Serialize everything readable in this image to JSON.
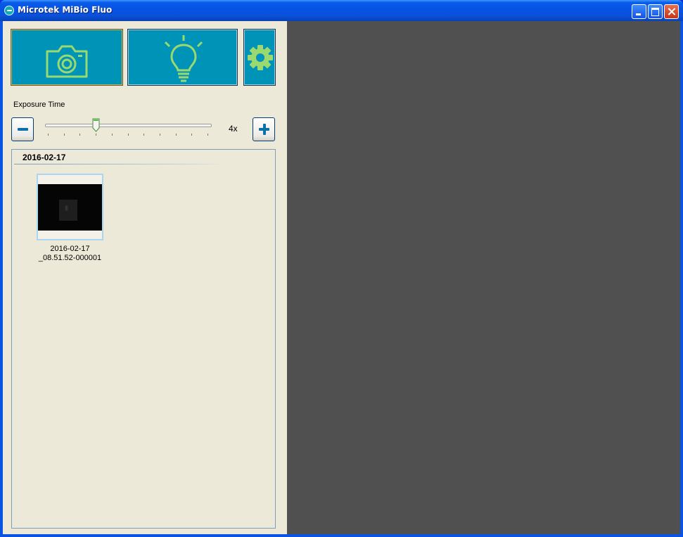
{
  "window": {
    "title": "Microtek MiBio Fluo",
    "controls": {
      "minimize": "minimize",
      "maximize": "maximize",
      "close": "close"
    }
  },
  "toolbar": {
    "buttons": [
      {
        "id": "camera",
        "icon": "camera-icon"
      },
      {
        "id": "light",
        "icon": "lightbulb-icon"
      },
      {
        "id": "settings",
        "icon": "gear-icon"
      }
    ],
    "icon_color": "#9ad870",
    "button_color": "#0093b8"
  },
  "exposure": {
    "label": "Exposure Time",
    "value_label": "4x",
    "slider_level": 0.3,
    "tick_count": 11
  },
  "gallery": {
    "group_date": "2016-02-17",
    "items": [
      {
        "caption_line1": "2016-02-17",
        "caption_line2": "_08.51.52-000001"
      }
    ]
  },
  "colors": {
    "titlebar": "#0a54e3",
    "pane_background": "#ece9d8",
    "viewer_background": "#505050"
  }
}
